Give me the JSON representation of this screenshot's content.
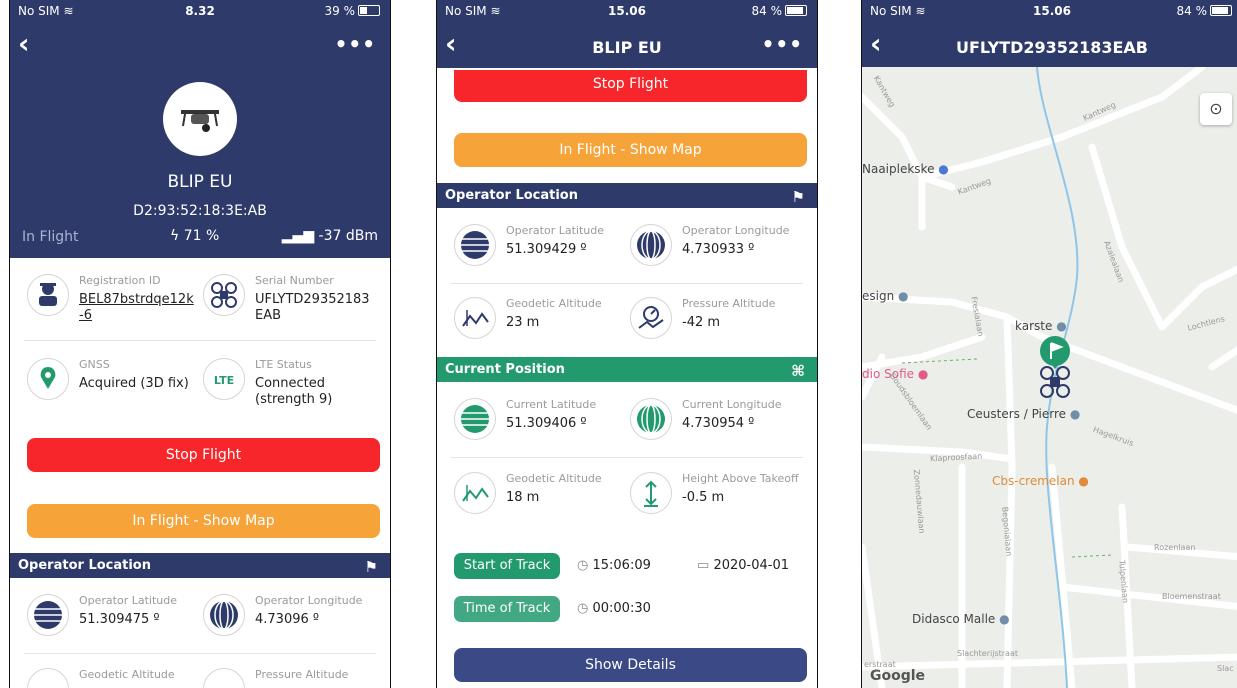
{
  "screen1": {
    "status": {
      "carrier": "No SIM",
      "time": "8.32",
      "battery": "39 %"
    },
    "device_name": "BLIP EU",
    "mac": "D2:93:52:18:3E:AB",
    "state": "In Flight",
    "battery_level": "71 %",
    "signal": "-37 dBm",
    "registration": {
      "label": "Registration ID",
      "value": "BEL87bstrdqe12k-6"
    },
    "serial": {
      "label": "Serial Number",
      "value": "UFLYTD29352183EAB"
    },
    "gnss": {
      "label": "GNSS",
      "value": "Acquired (3D fix)"
    },
    "lte": {
      "label": "LTE Status",
      "value": "Connected (strength 9)",
      "icon_text": "LTE"
    },
    "stop_button": "Stop Flight",
    "map_button": "In Flight - Show Map",
    "operator_section": "Operator Location",
    "op_lat": {
      "label": "Operator Latitude",
      "value": "51.309475 º"
    },
    "op_lon": {
      "label": "Operator Longitude",
      "value": "4.73096 º"
    },
    "geo_alt_label": "Geodetic Altitude",
    "press_alt_label": "Pressure Altitude"
  },
  "screen2": {
    "status": {
      "carrier": "No SIM",
      "time": "15.06",
      "battery": "84 %"
    },
    "title": "BLIP EU",
    "stop_button": "Stop Flight",
    "map_button": "In Flight - Show Map",
    "operator_section": "Operator Location",
    "op_lat": {
      "label": "Operator Latitude",
      "value": "51.309429 º"
    },
    "op_lon": {
      "label": "Operator Longitude",
      "value": "4.730933 º"
    },
    "op_geo": {
      "label": "Geodetic Altitude",
      "value": "23 m"
    },
    "op_press": {
      "label": "Pressure Altitude",
      "value": "-42 m"
    },
    "current_section": "Current Position",
    "cur_lat": {
      "label": "Current Latitude",
      "value": "51.309406 º"
    },
    "cur_lon": {
      "label": "Current Longitude",
      "value": "4.730954 º"
    },
    "cur_geo": {
      "label": "Geodetic Altitude",
      "value": "18 m"
    },
    "cur_height": {
      "label": "Height Above Takeoff",
      "value": "-0.5 m"
    },
    "start_track": {
      "label": "Start of Track",
      "time": "15:06:09",
      "date": "2020-04-01"
    },
    "time_track": {
      "label": "Time of Track",
      "time": "00:00:30"
    },
    "details_button": "Show Details"
  },
  "screen3": {
    "status": {
      "carrier": "No SIM",
      "time": "15.06",
      "battery": "84 %"
    },
    "title": "UFLYTD29352183EAB",
    "places": {
      "naaipl": "Naaiplekske",
      "design": "esign",
      "karste": "karste",
      "sofie": "dio Sofie",
      "ceusters": "Ceusters / Pierre",
      "cbs": "Cbs-cremelan",
      "didasco": "Didasco Malle"
    },
    "streets": [
      "Kantweg",
      "Kantweg",
      "Kantweg",
      "Azalealaan",
      "Fresialaan",
      "Lochtlens",
      "Goudsbloemlaan",
      "Hagelkruis",
      "Klaproosfaan",
      "Zonnedauwlaan",
      "Begonialaan",
      "Rozenlaan",
      "Tulpenlaan",
      "Bloemenstraat",
      "Slachterijstraat",
      "erstraat",
      "Slac"
    ],
    "google": "Google"
  },
  "colors": {
    "navy": "#2e3a6a",
    "red": "#f6262a",
    "orange": "#f6a43a",
    "green": "#229a6e"
  }
}
